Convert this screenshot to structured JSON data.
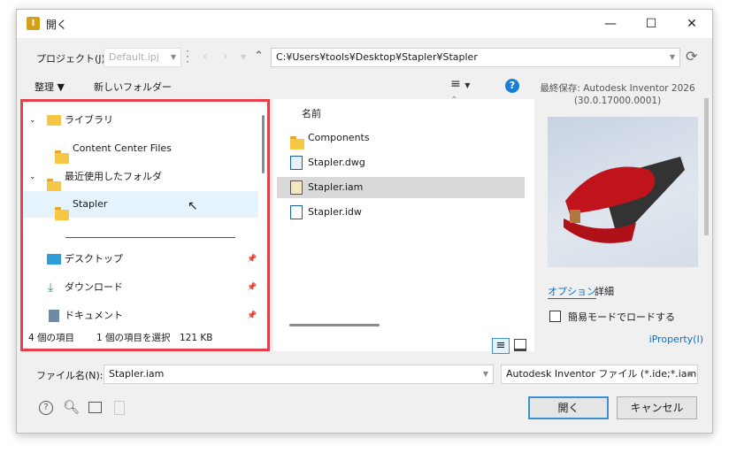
{
  "window": {
    "title": "開く",
    "minimize": "—",
    "maximize": "☐",
    "close": "✕"
  },
  "toolbar": {
    "project_label": "プロジェクト(J):",
    "project_value": "Default.ipj",
    "path": "C:¥Users¥tools¥Desktop¥Stapler¥Stapler",
    "organize": "整理 ▼",
    "new_folder": "新しいフォルダー",
    "help": "?"
  },
  "nav": {
    "items": [
      {
        "label": "ライブラリ"
      },
      {
        "label": "Content Center Files"
      },
      {
        "label": "最近使用したフォルダ"
      },
      {
        "label": "Stapler"
      },
      {
        "label": "デスクトップ"
      },
      {
        "label": "ダウンロード"
      },
      {
        "label": "ドキュメント"
      }
    ]
  },
  "files": {
    "column_name": "名前",
    "items": [
      {
        "name": "Components"
      },
      {
        "name": "Stapler.dwg"
      },
      {
        "name": "Stapler.iam"
      },
      {
        "name": "Stapler.idw"
      }
    ]
  },
  "status": {
    "count": "4 個の項目",
    "selected": "1 個の項目を選択",
    "size": "121 KB"
  },
  "preview": {
    "saved_by": "最終保存: Autodesk Inventor 2026",
    "version": "(30.0.17000.0001)",
    "tab_options": "オプション",
    "tab_details": "詳細",
    "express_mode": "簡易モードでロードする",
    "iproperty": "iProperty(I)"
  },
  "bottom": {
    "filename_label": "ファイル名(N):",
    "filename_value": "Stapler.iam",
    "filter": "Autodesk Inventor ファイル (*.ide;*.iam;*.i...",
    "open": "開く",
    "cancel": "キャンセル"
  }
}
